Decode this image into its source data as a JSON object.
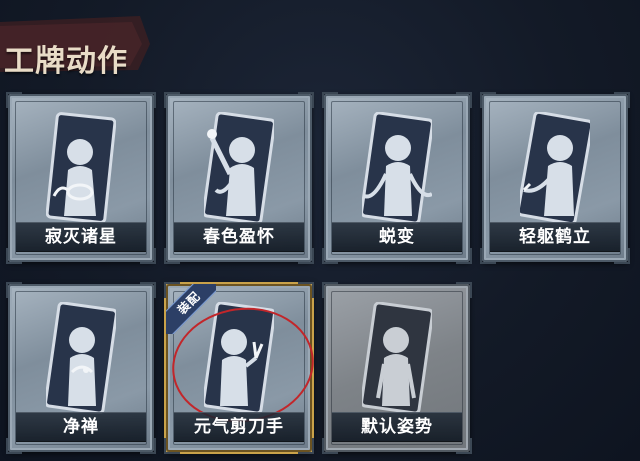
{
  "header": {
    "title": "工牌动作"
  },
  "cards": [
    {
      "label": "寂灭诸星",
      "equipped": false,
      "icon": "pose-silhouette-hands-circle-icon"
    },
    {
      "label": "春色盈怀",
      "equipped": false,
      "icon": "pose-silhouette-flower-icon"
    },
    {
      "label": "蜕变",
      "equipped": false,
      "icon": "pose-silhouette-arms-open-icon"
    },
    {
      "label": "轻躯鹤立",
      "equipped": false,
      "icon": "pose-silhouette-crane-icon"
    },
    {
      "label": "净禅",
      "equipped": false,
      "icon": "pose-silhouette-zen-icon"
    },
    {
      "label": "元气剪刀手",
      "equipped": true,
      "badge": "装配",
      "icon": "pose-silhouette-peace-sign-icon"
    },
    {
      "label": "默认姿势",
      "equipped": false,
      "icon": "pose-silhouette-default-icon"
    }
  ],
  "colors": {
    "background": "#131a27",
    "frame": "#8a99a7",
    "equipped_border": "#c9a24a",
    "badge": "#2c3f66",
    "highlight_circle": "#c2262a"
  }
}
